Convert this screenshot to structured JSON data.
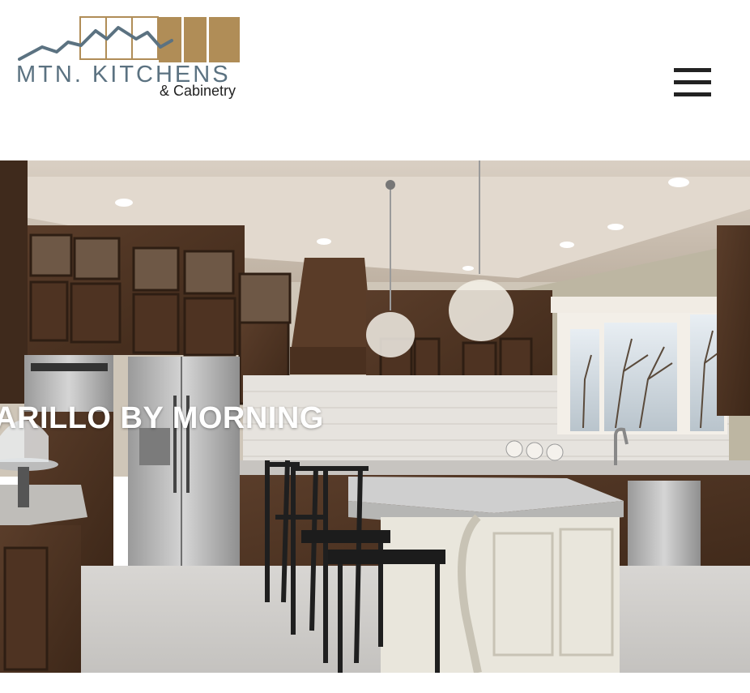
{
  "brand": {
    "name": "MTN. KITCHENS",
    "tagline": "& Cabinetry",
    "colors": {
      "slate": "#5b7281",
      "gold": "#b08d57"
    }
  },
  "nav": {
    "menu_icon": "hamburger-menu-icon"
  },
  "hero": {
    "title": "IARILLO BY MORNING",
    "image": "kitchen-photo"
  }
}
